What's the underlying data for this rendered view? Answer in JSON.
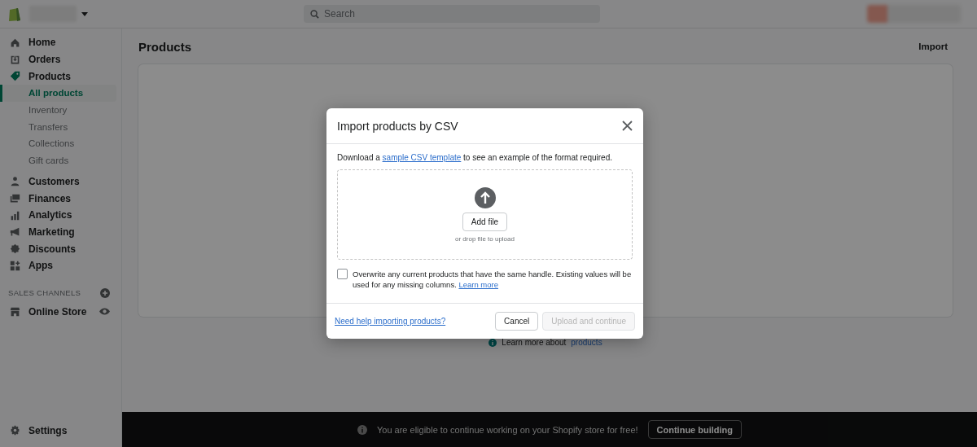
{
  "top_bar": {
    "search": {
      "placeholder": "Search"
    }
  },
  "sidebar": {
    "items": [
      {
        "label": "Home",
        "selected": false
      },
      {
        "label": "Orders",
        "selected": false
      },
      {
        "label": "Products",
        "selected": false,
        "children": [
          {
            "label": "All products",
            "selected": true
          },
          {
            "label": "Inventory",
            "selected": false
          },
          {
            "label": "Transfers",
            "selected": false
          },
          {
            "label": "Collections",
            "selected": false
          },
          {
            "label": "Gift cards",
            "selected": false
          }
        ]
      },
      {
        "label": "Customers",
        "selected": false
      },
      {
        "label": "Finances",
        "selected": false
      },
      {
        "label": "Analytics",
        "selected": false
      },
      {
        "label": "Marketing",
        "selected": false
      },
      {
        "label": "Discounts",
        "selected": false
      },
      {
        "label": "Apps",
        "selected": false
      }
    ],
    "sales_channels": {
      "heading": "SALES CHANNELS",
      "items": [
        {
          "label": "Online Store",
          "selected": false
        }
      ]
    },
    "settings": {
      "label": "Settings"
    }
  },
  "page": {
    "title": "Products",
    "action": "Import",
    "learn_more": {
      "text": "Learn more about",
      "link": "products"
    }
  },
  "modal": {
    "title": "Import products by CSV",
    "description": {
      "before": "Download a ",
      "link": "sample CSV template",
      "after": " to see an example of the format required."
    },
    "add_file": "Add file",
    "drop_hint": "or drop file to upload",
    "overwrite": {
      "checked": false,
      "label": "Overwrite any current products that have the same handle. Existing values will be used for any missing columns.",
      "link": "Learn more"
    },
    "help_link": "Need help importing products?",
    "cancel": "Cancel",
    "submit": {
      "label": "Upload and continue",
      "disabled": true
    }
  },
  "banner": {
    "message": "You are eligible to continue working on your Shopify store for free!",
    "button": "Continue building"
  }
}
